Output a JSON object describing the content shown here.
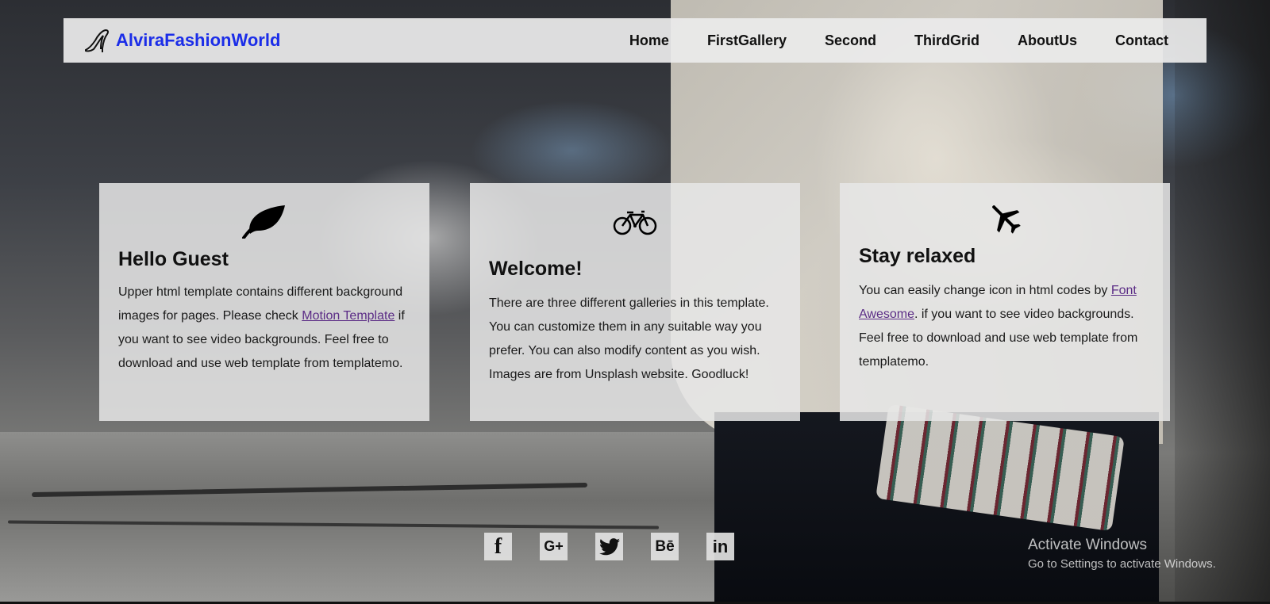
{
  "brand": {
    "name": "AlviraFashionWorld",
    "icon": "high-heel-icon",
    "color": "#1b2de8"
  },
  "nav": [
    {
      "label": "Home"
    },
    {
      "label": "FirstGallery"
    },
    {
      "label": "Second"
    },
    {
      "label": "ThirdGrid"
    },
    {
      "label": "AboutUs"
    },
    {
      "label": "Contact"
    }
  ],
  "cards": [
    {
      "icon": "leaf-icon",
      "title": "Hello Guest",
      "text_before": "Upper html template contains different background images for pages. Please check ",
      "link": "Motion Template",
      "text_after": " if you want to see video backgrounds. Feel free to download and use web template from templatemo."
    },
    {
      "icon": "bicycle-icon",
      "title": "Welcome!",
      "text": "There are three different galleries in this template. You can customize them in any suitable way you prefer. You can also modify content as you wish. Images are from Unsplash website. Goodluck!"
    },
    {
      "icon": "plane-icon",
      "title": "Stay relaxed",
      "text_before": "You can easily change icon in html codes by ",
      "link": "Font Awesome",
      "text_after": ". if you want to see video backgrounds. Feel free to download and use web template from templatemo."
    }
  ],
  "social": [
    {
      "icon": "facebook-icon",
      "glyph": "f"
    },
    {
      "icon": "google-plus-icon",
      "glyph": "G+"
    },
    {
      "icon": "twitter-icon",
      "glyph": ""
    },
    {
      "icon": "behance-icon",
      "glyph": "Bē"
    },
    {
      "icon": "linkedin-icon",
      "glyph": "in"
    }
  ],
  "watermark": {
    "title": "Activate Windows",
    "subtitle": "Go to Settings to activate Windows."
  },
  "colors": {
    "link": "#5b2c86",
    "card_bg": "#e6e6e6"
  }
}
